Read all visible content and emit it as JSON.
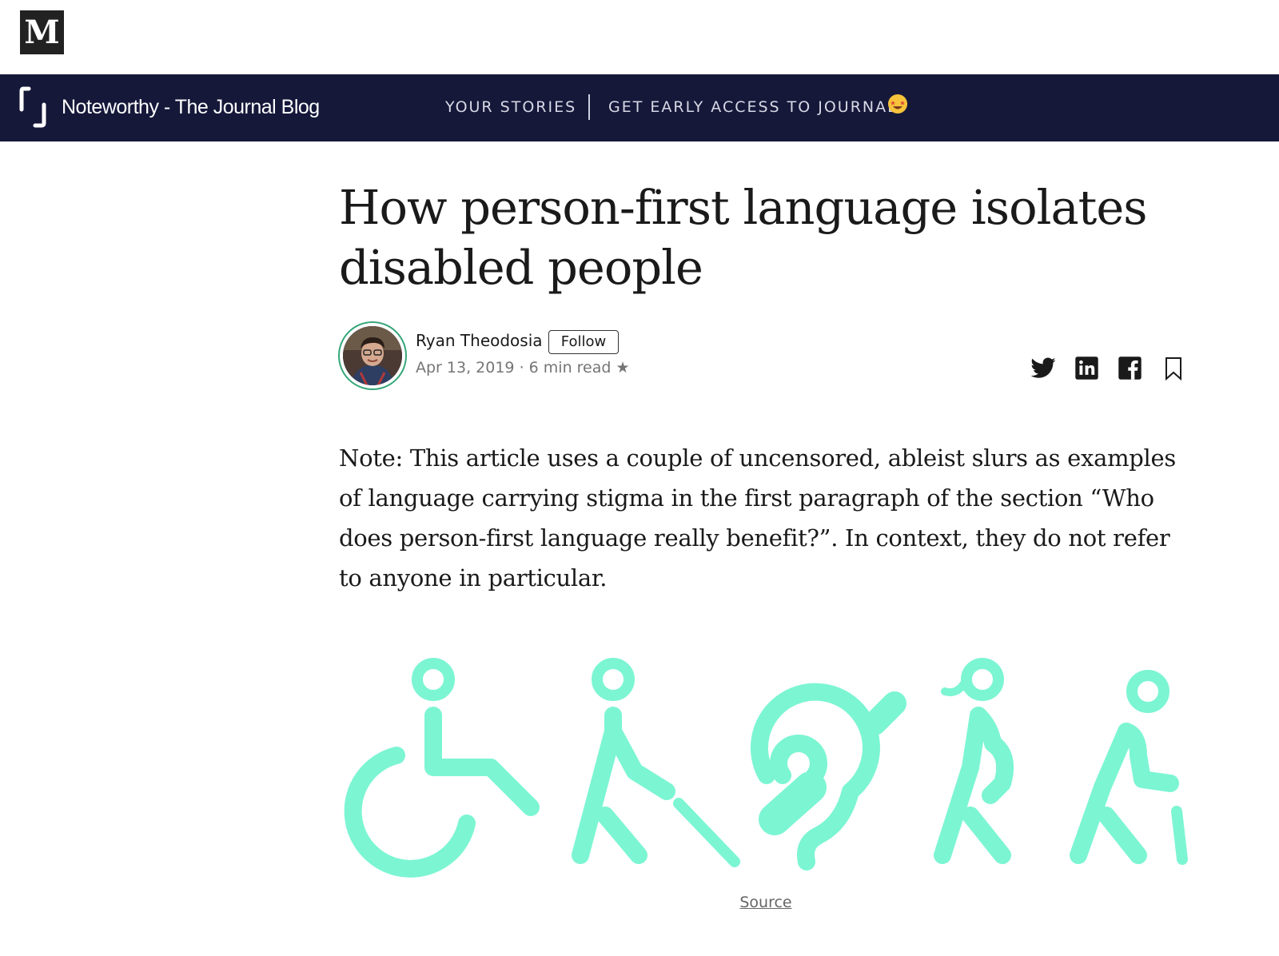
{
  "site": {
    "logo_letter": "M",
    "logo_icon": "medium-logo-icon"
  },
  "publication": {
    "name": "Noteworthy - The Journal Blog",
    "logo_icon": "journal-bracket-icon",
    "nav": {
      "stories_label": "YOUR STORIES",
      "access_label": "GET EARLY ACCESS TO JOURNAL",
      "access_emoji_icon": "star-struck-emoji-icon"
    },
    "colors": {
      "nav_background": "#16183a",
      "nav_text": "#d8d9e6"
    }
  },
  "article": {
    "title": "How person-first language isolates disabled people",
    "author": {
      "name": "Ryan Theodosia",
      "follow_label": "Follow",
      "avatar_ring_color": "#35a67a"
    },
    "meta": {
      "date": "Apr 13, 2019",
      "separator": " · ",
      "read_time": "6 min read",
      "star": "★"
    },
    "share_icons": [
      "twitter-icon",
      "linkedin-icon",
      "facebook-icon",
      "bookmark-icon"
    ],
    "body": "Note: This article uses a couple of uncensored, ableist slurs as examples of language carrying stigma in the first paragraph of the section “Who does person-first language really benefit?”. In context, they do not refer to anyone in particular.",
    "figure": {
      "icons": [
        "wheelchair-icon",
        "blind-person-cane-icon",
        "hearing-impaired-icon",
        "pregnant-person-icon",
        "elderly-person-cane-icon"
      ],
      "color": "#7cf5d3",
      "caption_link": "Source"
    }
  }
}
